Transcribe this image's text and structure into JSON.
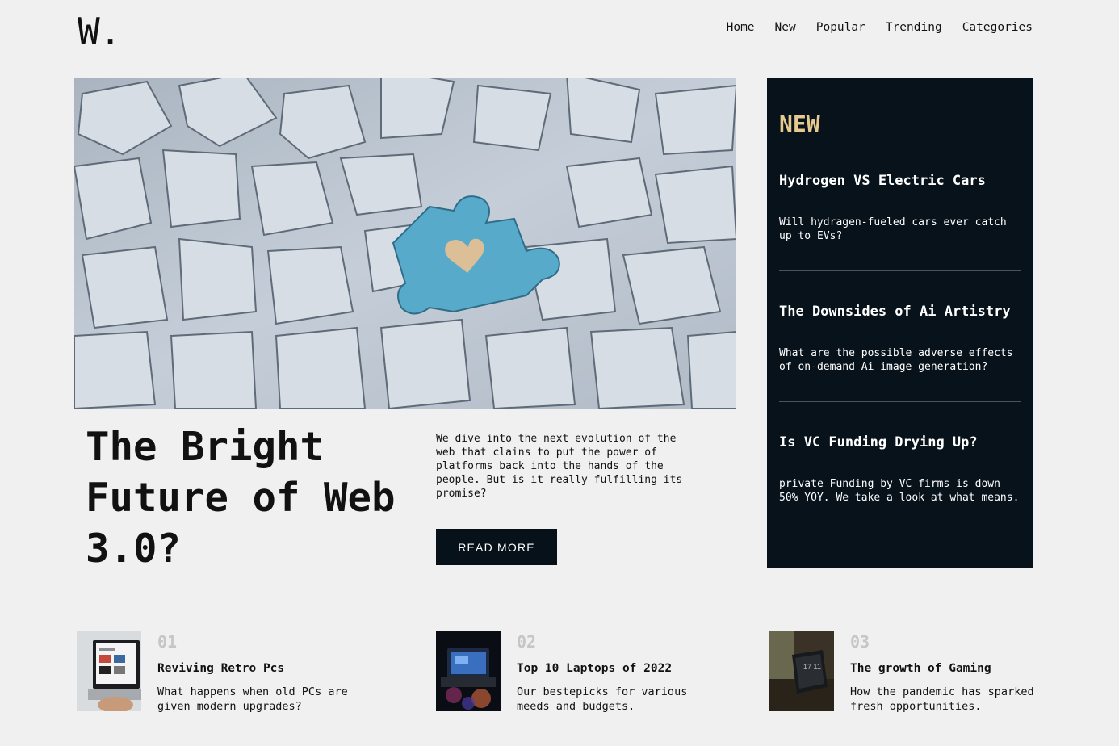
{
  "brand": {
    "logo": "W."
  },
  "nav": {
    "items": [
      "Home",
      "New",
      "Popular",
      "Trending",
      "Categories"
    ]
  },
  "hero": {
    "image": "puzzle-pieces-with-blue-heart-piece",
    "title": "The Bright Future of Web 3.0?",
    "description": "We dive into the next evolution of the web that clains to put the power of platforms back into the hands of the people. But is it really fulfilling its promise?",
    "button_label": "READ MORE"
  },
  "sidebar": {
    "heading": "NEW",
    "items": [
      {
        "title": "Hydrogen VS Electric Cars",
        "description": "Will hydragen-fueled cars ever catch up to EVs?"
      },
      {
        "title": "The Downsides of Ai Artistry",
        "description": "What are the possible adverse effects of on-demand Ai image generation?"
      },
      {
        "title": "Is VC Funding Drying Up?",
        "description": "private Funding by VC firms is down 50% YOY. We take a look at what means."
      }
    ]
  },
  "articles": [
    {
      "number": "01",
      "title": "Reviving Retro Pcs",
      "description": "What happens when old PCs are given modern upgrades?",
      "image": "laptop-photo"
    },
    {
      "number": "02",
      "title": "Top 10 Laptops of 2022",
      "description": "Our bestepicks for various meeds and budgets.",
      "image": "laptop-in-dark-photo"
    },
    {
      "number": "03",
      "title": "The growth of Gaming",
      "description": "How the pandemic has sparked fresh opportunities.",
      "image": "tablet-on-desk-photo"
    }
  ],
  "colors": {
    "background": "#f0f0f0",
    "dark": "#07121b",
    "accent": "#e6c98e",
    "muted_number": "#c6c6c6"
  }
}
